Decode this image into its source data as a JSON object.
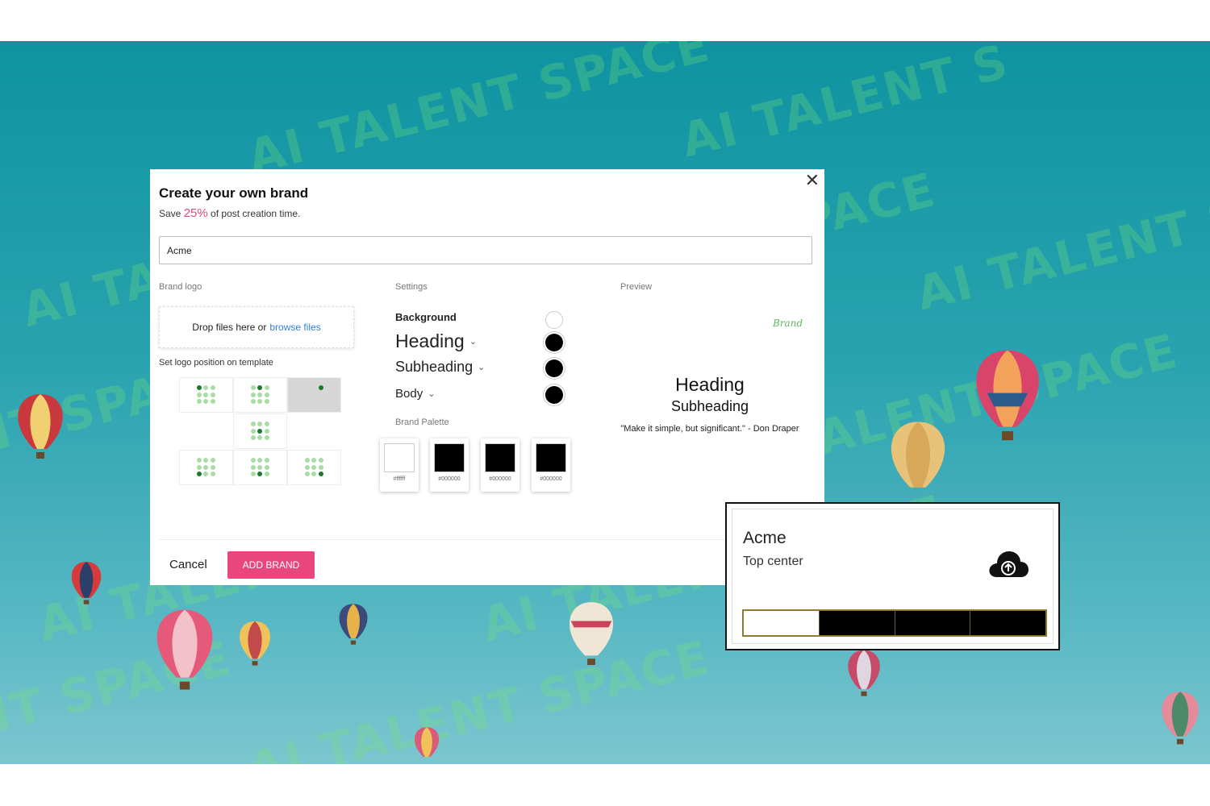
{
  "modal": {
    "title": "Create your own brand",
    "subtitle_before": "Save ",
    "subtitle_percent": "25%",
    "subtitle_after": " of post creation time.",
    "brand_name_value": "Acme",
    "close_icon": "close-icon"
  },
  "brand_logo": {
    "label": "Brand logo",
    "drop_text": "Drop files here or",
    "browse_link": "browse files",
    "position_label": "Set logo position on template",
    "selected_position": "top-right"
  },
  "settings": {
    "label": "Settings",
    "background": {
      "label": "Background",
      "color": "#ffffff"
    },
    "heading": {
      "label": "Heading",
      "color": "#000000"
    },
    "subheading": {
      "label": "Subheading",
      "color": "#000000"
    },
    "body": {
      "label": "Body",
      "color": "#000000"
    },
    "palette_label": "Brand Palette",
    "palette": [
      {
        "hex": "#ffffff",
        "color": "#ffffff"
      },
      {
        "hex": "#000000",
        "color": "#000000"
      },
      {
        "hex": "#000000",
        "color": "#000000"
      },
      {
        "hex": "#000000",
        "color": "#000000"
      }
    ]
  },
  "preview": {
    "label": "Preview",
    "brand_mark": "Brand",
    "heading": "Heading",
    "subheading": "Subheading",
    "quote": "\"Make it simple, but significant.\" - Don Draper"
  },
  "footer": {
    "cancel_label": "Cancel",
    "add_label": "ADD BRAND"
  },
  "brand_card": {
    "name": "Acme",
    "position": "Top center",
    "upload_icon": "cloud-upload-icon",
    "palette_colors": [
      "#ffffff",
      "#000000",
      "#000000",
      "#000000"
    ]
  },
  "colors": {
    "accent": "#e8467c",
    "link": "#2f7fd9",
    "sky": "#1a9aa8"
  }
}
